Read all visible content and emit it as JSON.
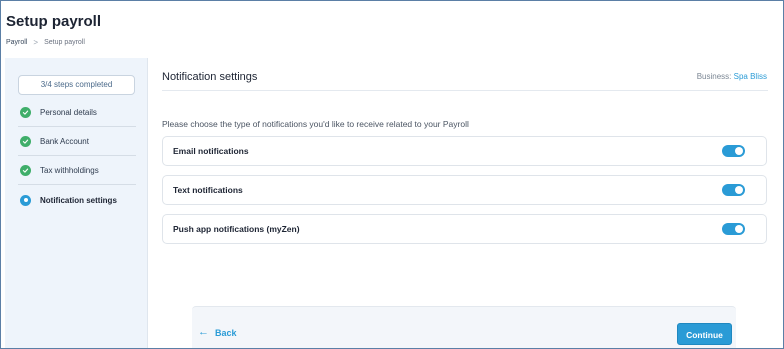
{
  "header": {
    "title": "Setup payroll",
    "breadcrumb": {
      "parent": "Payroll",
      "separator": ">",
      "current": "Setup payroll"
    }
  },
  "sidebar": {
    "progress": "3/4 steps completed",
    "steps": [
      {
        "label": "Personal details",
        "status": "done"
      },
      {
        "label": "Bank Account",
        "status": "done"
      },
      {
        "label": "Tax withholdings",
        "status": "done"
      },
      {
        "label": "Notification settings",
        "status": "current"
      }
    ]
  },
  "main": {
    "section_title": "Notification settings",
    "business_label": "Business:",
    "business_name": "Spa Bliss",
    "instruction": "Please choose the type of notifications you'd like to receive related to your Payroll",
    "notifications": [
      {
        "label": "Email notifications",
        "enabled": true
      },
      {
        "label": "Text notifications",
        "enabled": true
      },
      {
        "label": "Push app notifications (myZen)",
        "enabled": true
      }
    ]
  },
  "footer": {
    "back_label": "Back",
    "back_icon": "arrow-left-icon",
    "continue_label": "Continue"
  },
  "colors": {
    "accent": "#2a9bd6",
    "success": "#3fae6a",
    "sidebar_bg": "#eef4fb"
  }
}
